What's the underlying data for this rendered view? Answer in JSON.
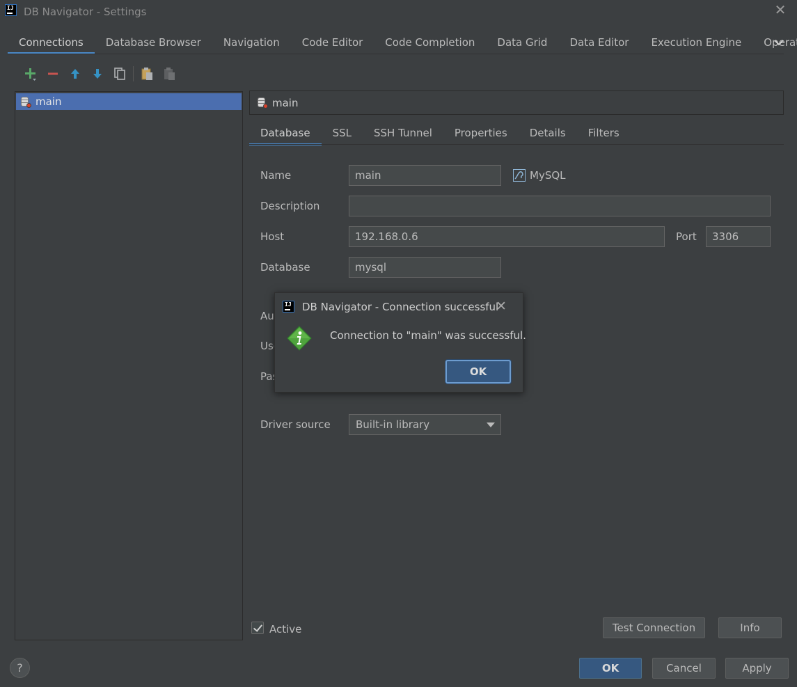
{
  "window": {
    "title": "DB Navigator - Settings"
  },
  "top_tabs": [
    {
      "label": "Connections"
    },
    {
      "label": "Database Browser"
    },
    {
      "label": "Navigation"
    },
    {
      "label": "Code Editor"
    },
    {
      "label": "Code Completion"
    },
    {
      "label": "Data Grid"
    },
    {
      "label": "Data Editor"
    },
    {
      "label": "Execution Engine"
    },
    {
      "label": "Operations"
    }
  ],
  "toolbar": {
    "icons": [
      "add-icon",
      "remove-icon",
      "move-up-icon",
      "move-down-icon",
      "copy-icon",
      "paste-icon",
      "paste-disabled-icon"
    ]
  },
  "connections": [
    {
      "label": "main"
    }
  ],
  "connection_header": {
    "label": "main"
  },
  "sub_tabs": [
    {
      "label": "Database"
    },
    {
      "label": "SSL"
    },
    {
      "label": "SSH Tunnel"
    },
    {
      "label": "Properties"
    },
    {
      "label": "Details"
    },
    {
      "label": "Filters"
    }
  ],
  "form": {
    "name_label": "Name",
    "name_value": "main",
    "db_type": "MySQL",
    "description_label": "Description",
    "description_value": "",
    "host_label": "Host",
    "host_value": "192.168.0.6",
    "port_label": "Port",
    "port_value": "3306",
    "database_label": "Database",
    "database_value": "mysql",
    "auth_label_partial": "Au",
    "user_label_partial": "Use",
    "password_label_partial": "Pas",
    "driver_source_label": "Driver source",
    "driver_source_value": "Built-in library"
  },
  "active": {
    "label": "Active",
    "checked": true
  },
  "buttons": {
    "test_connection": "Test Connection",
    "info": "Info",
    "ok": "OK",
    "cancel": "Cancel",
    "apply": "Apply",
    "help": "?"
  },
  "popup": {
    "title": "DB Navigator - Connection successful",
    "message": "Connection to \"main\" was successful.",
    "ok": "OK"
  },
  "colors": {
    "background": "#3c3f41",
    "accent": "#4a88c7",
    "selection": "#4b6eaf",
    "primary_button": "#365880"
  }
}
